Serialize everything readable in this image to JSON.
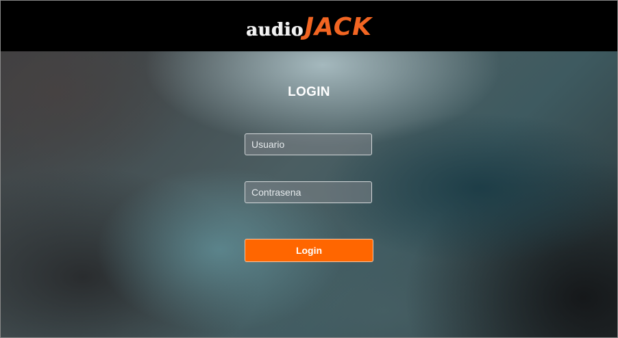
{
  "header": {
    "logo_prefix": "audio",
    "logo_brand": "JACK"
  },
  "login": {
    "title": "LOGIN",
    "username_placeholder": "Usuario",
    "password_placeholder": "Contrasena",
    "submit_label": "Login"
  },
  "colors": {
    "header_background": "#000000",
    "brand_accent": "#f26522",
    "button_background": "#ff6600",
    "button_text": "#ffffff"
  }
}
